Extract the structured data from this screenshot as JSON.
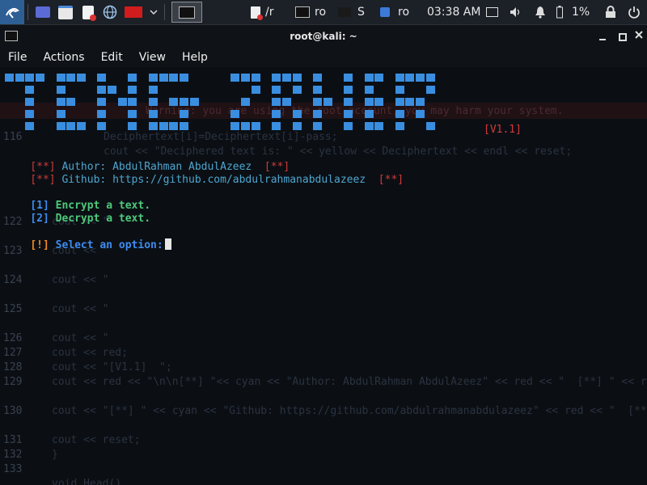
{
  "panel": {
    "tasks": [
      "/r",
      "ro",
      "S",
      "ro"
    ],
    "clock": "03:38 AM",
    "battery": "1%"
  },
  "window": {
    "title": "root@kali: ~"
  },
  "menu": [
    "File",
    "Actions",
    "Edit",
    "View",
    "Help"
  ],
  "terminal": {
    "version": "[V1.1]",
    "author_prefix": "[**]",
    "author_text": "Author: AbdulRahman AbdulAzeez",
    "author_suffix": "[**]",
    "github_prefix": "[**]",
    "github_text": "Github: https://github.com/abdulrahmanabdulazeez",
    "github_suffix": "[**]",
    "opt1_num": "[1]",
    "opt1_text": "Encrypt a text.",
    "opt2_num": "[2]",
    "opt2_text": "Decrypt a text.",
    "prompt_prefix": "[!]",
    "prompt_text": "Select an option:"
  },
  "background_code": {
    "lines": [
      {
        "num": "116",
        "code": "Deciphertext[i]=Deciphertext[i]-pass;"
      },
      {
        "num": "",
        "code": "cout << \"Deciphered text is: \" << yellow << Deciphertext << endl << reset;"
      },
      {
        "num": "122",
        "code": "cout << \""
      },
      {
        "num": "123",
        "code": "cout << \""
      },
      {
        "num": "124",
        "code": "cout << \""
      },
      {
        "num": "125",
        "code": "cout << \""
      },
      {
        "num": "126",
        "code": "cout << \""
      },
      {
        "num": "127",
        "code": "cout << red;"
      },
      {
        "num": "128",
        "code": "cout << \"[V1.1]  \";"
      },
      {
        "num": "129",
        "code": "cout << red << \"\\n\\n[**] \"<< cyan << \"Author: AbdulRahman AbdulAzeez\" << red << \"  [**] \" << red;"
      },
      {
        "num": "130",
        "code": "cout << \"[**] \" << cyan << \"Github: https://github.com/abdulrahmanabdulazeez\" << red << \"  [**]\\n\";"
      },
      {
        "num": "131",
        "code": "cout << reset;"
      },
      {
        "num": "132",
        "code": "}"
      },
      {
        "num": "133",
        "code": ""
      },
      {
        "num": "",
        "code": "void Head()"
      }
    ],
    "warning": "Warning: you are using the root account, you may harm your system."
  }
}
